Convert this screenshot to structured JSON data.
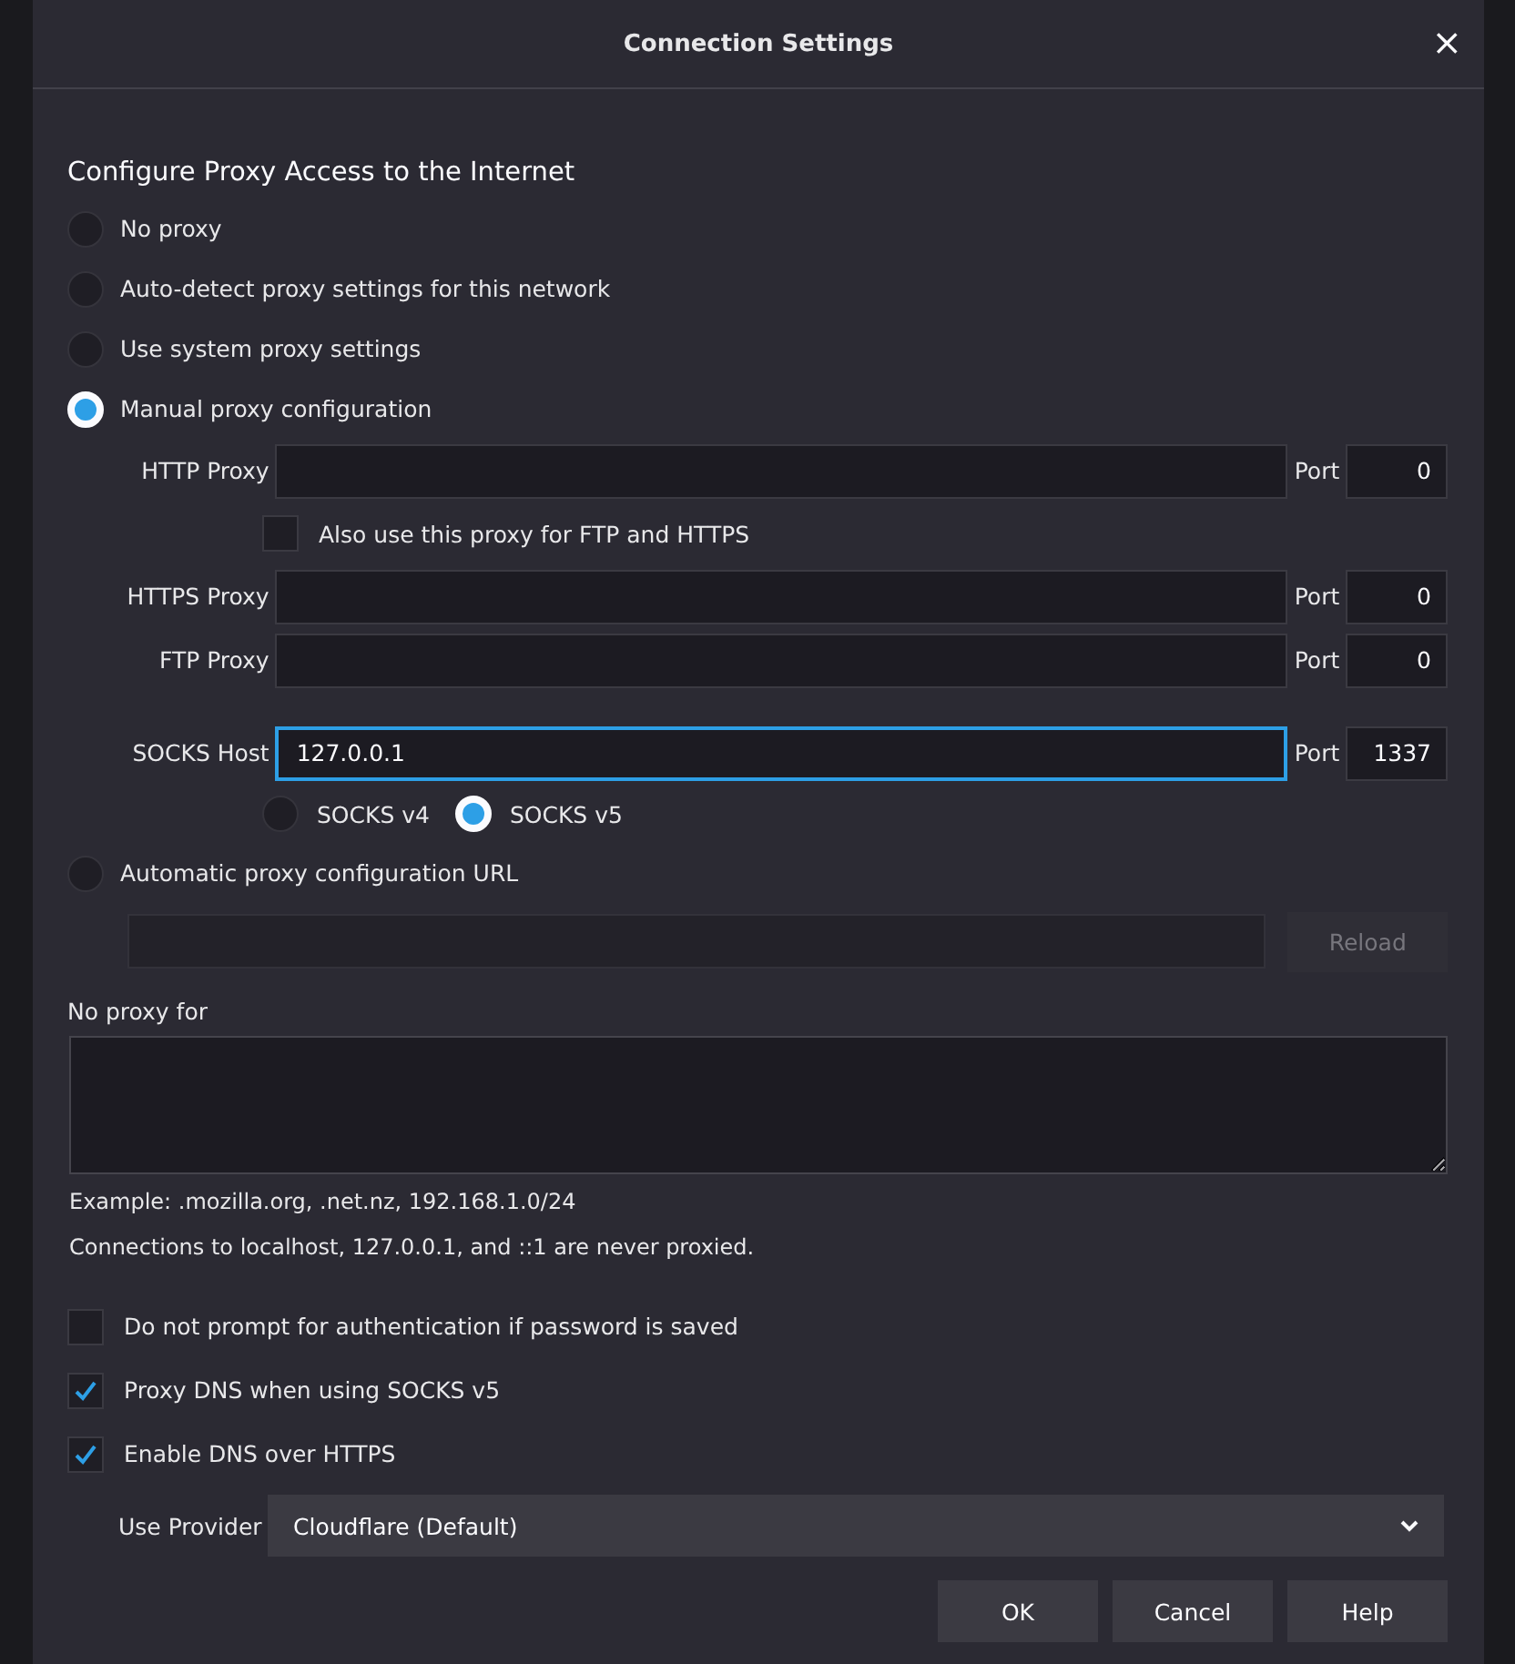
{
  "window": {
    "title": "Connection Settings",
    "close": "×"
  },
  "heading": "Configure Proxy Access to the Internet",
  "proxy_modes": [
    {
      "label": "No proxy",
      "selected": false
    },
    {
      "label": "Auto-detect proxy settings for this network",
      "selected": false
    },
    {
      "label": "Use system proxy settings",
      "selected": false
    },
    {
      "label": "Manual proxy configuration",
      "selected": true
    }
  ],
  "proxies": [
    {
      "label": "HTTP Proxy",
      "focused": false,
      "port_label": "Port",
      "port": "0"
    },
    {
      "label": "HTTPS Proxy",
      "focused": false,
      "port_label": "Port",
      "port": "0"
    },
    {
      "label": "FTP Proxy",
      "focused": false,
      "port_label": "Port",
      "port": "0"
    },
    {
      "label": "SOCKS Host",
      "value": "127.0.0.1",
      "focused": true,
      "port_label": "Port",
      "port": "1337"
    }
  ],
  "share_proxy": {
    "label": "Also use this proxy for FTP and HTTPS",
    "checked": false
  },
  "socks_versions": [
    {
      "label": "SOCKS v4",
      "selected": false
    },
    {
      "label": "SOCKS v5",
      "selected": true
    }
  ],
  "auto_url": {
    "label": "Automatic proxy configuration URL",
    "selected": false,
    "reload": {
      "label": "Reload",
      "disabled": true
    }
  },
  "no_proxy": {
    "label": "No proxy for"
  },
  "notes": [
    "Example: .mozilla.org, .net.nz, 192.168.1.0/24",
    "Connections to localhost, 127.0.0.1, and ::1 are never proxied."
  ],
  "options": [
    {
      "label": "Do not prompt for authentication if password is saved",
      "checked": false
    },
    {
      "label": "Proxy DNS when using SOCKS v5",
      "checked": true
    },
    {
      "label": "Enable DNS over HTTPS",
      "checked": true
    }
  ],
  "provider": {
    "label": "Use Provider",
    "value": "Cloudflare (Default)"
  },
  "buttons": [
    {
      "label": "OK"
    },
    {
      "label": "Cancel"
    },
    {
      "label": "Help"
    }
  ]
}
